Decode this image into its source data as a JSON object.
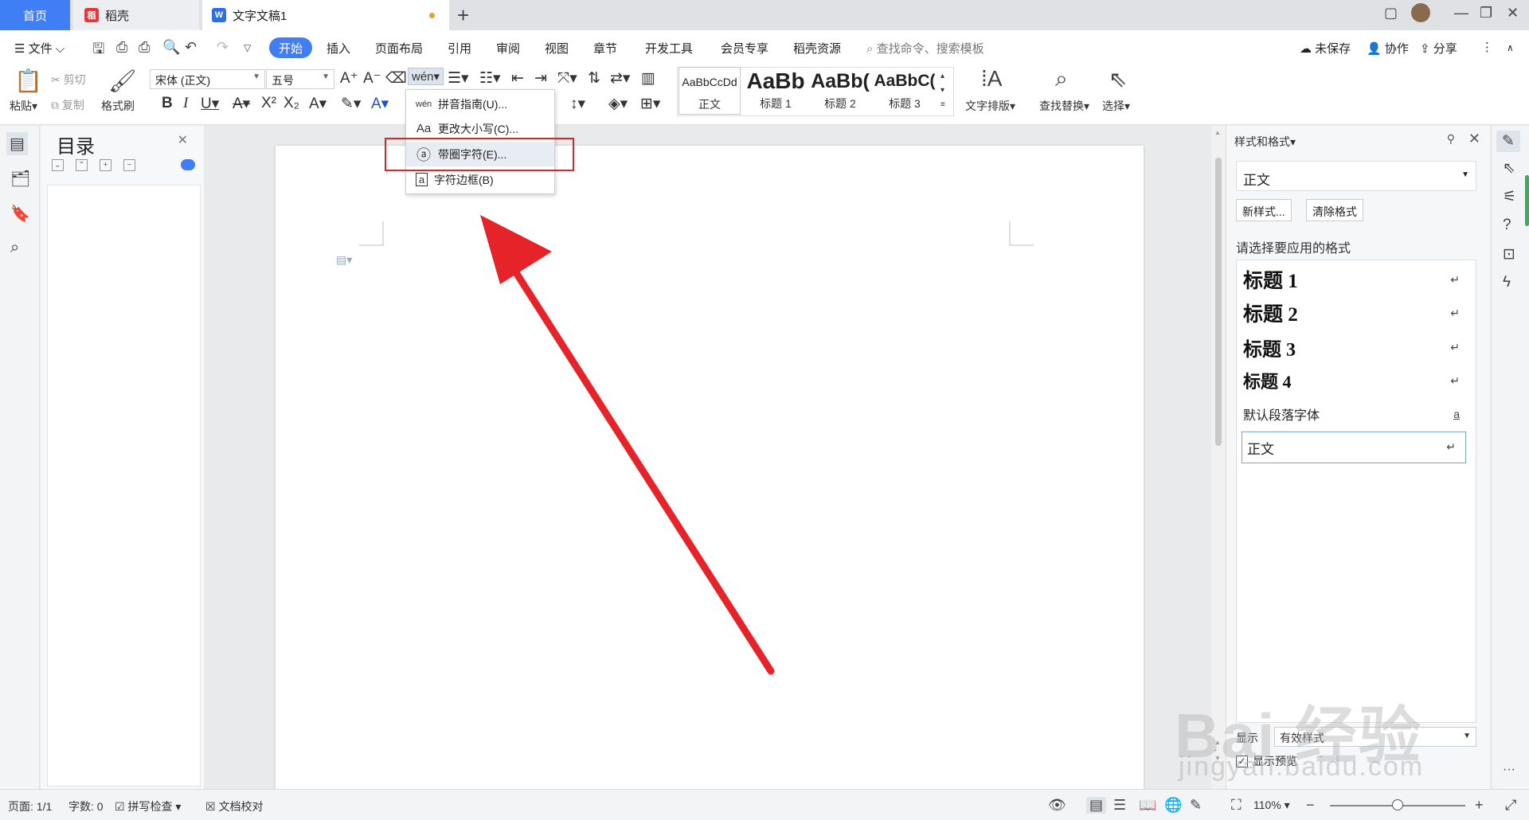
{
  "tabs": {
    "home": "首页",
    "daoke": "稻壳",
    "doc": "文字文稿1",
    "add": "+"
  },
  "menubar": {
    "file": "文件",
    "items": [
      "开始",
      "插入",
      "页面布局",
      "引用",
      "审阅",
      "视图",
      "章节",
      "开发工具",
      "会员专享",
      "稻壳资源"
    ],
    "search_placeholder": "查找命令、搜索模板",
    "unsaved": "未保存",
    "collaborate": "协作",
    "share": "分享"
  },
  "ribbon": {
    "paste": "粘贴",
    "cut": "剪切",
    "copy": "复制",
    "format_painter": "格式刷",
    "font_name": "宋体 (正文)",
    "font_size": "五号",
    "styles": [
      {
        "preview": "AaBbCcDd",
        "label": "正文"
      },
      {
        "preview": "AaBb",
        "label": "标题 1"
      },
      {
        "preview": "AaBb(",
        "label": "标题 2"
      },
      {
        "preview": "AaBbC(",
        "label": "标题 3"
      }
    ],
    "text_layout": "文字排版",
    "find_replace": "查找替换",
    "select": "选择"
  },
  "dropdown": {
    "items": [
      {
        "icon": "wén",
        "label": "拼音指南(U)..."
      },
      {
        "icon": "Aa",
        "label": "更改大小写(C)..."
      },
      {
        "icon": "ⓐ",
        "label": "带圈字符(E)..."
      },
      {
        "icon": "a",
        "label": "字符边框(B)"
      }
    ],
    "highlighted_index": 2
  },
  "nav": {
    "title": "目录"
  },
  "stylepanel": {
    "title": "样式和格式",
    "current": "正文",
    "new_style": "新样式...",
    "clear_format": "清除格式",
    "prompt": "请选择要应用的格式",
    "items": [
      {
        "label": "标题 1",
        "mark": "↵"
      },
      {
        "label": "标题 2",
        "mark": "↵"
      },
      {
        "label": "标题 3",
        "mark": "↵"
      },
      {
        "label": "标题 4",
        "mark": "↵"
      },
      {
        "label": "默认段落字体",
        "mark": "a"
      },
      {
        "label": "正文",
        "mark": "↵"
      }
    ],
    "show_label": "显示",
    "show_value": "有效样式",
    "show_preview": "显示预览"
  },
  "statusbar": {
    "page": "页面: 1/1",
    "words": "字数: 0",
    "spellcheck": "拼写检查",
    "proofread": "文档校对",
    "zoom": "110%"
  },
  "watermark": {
    "logo": "Bai 经验",
    "url": "jingyan.baidu.com"
  },
  "colors": {
    "accent": "#3f7ef4",
    "highlight_box": "#e02325",
    "arrow": "#e52329",
    "daoke": "#e8353c"
  }
}
